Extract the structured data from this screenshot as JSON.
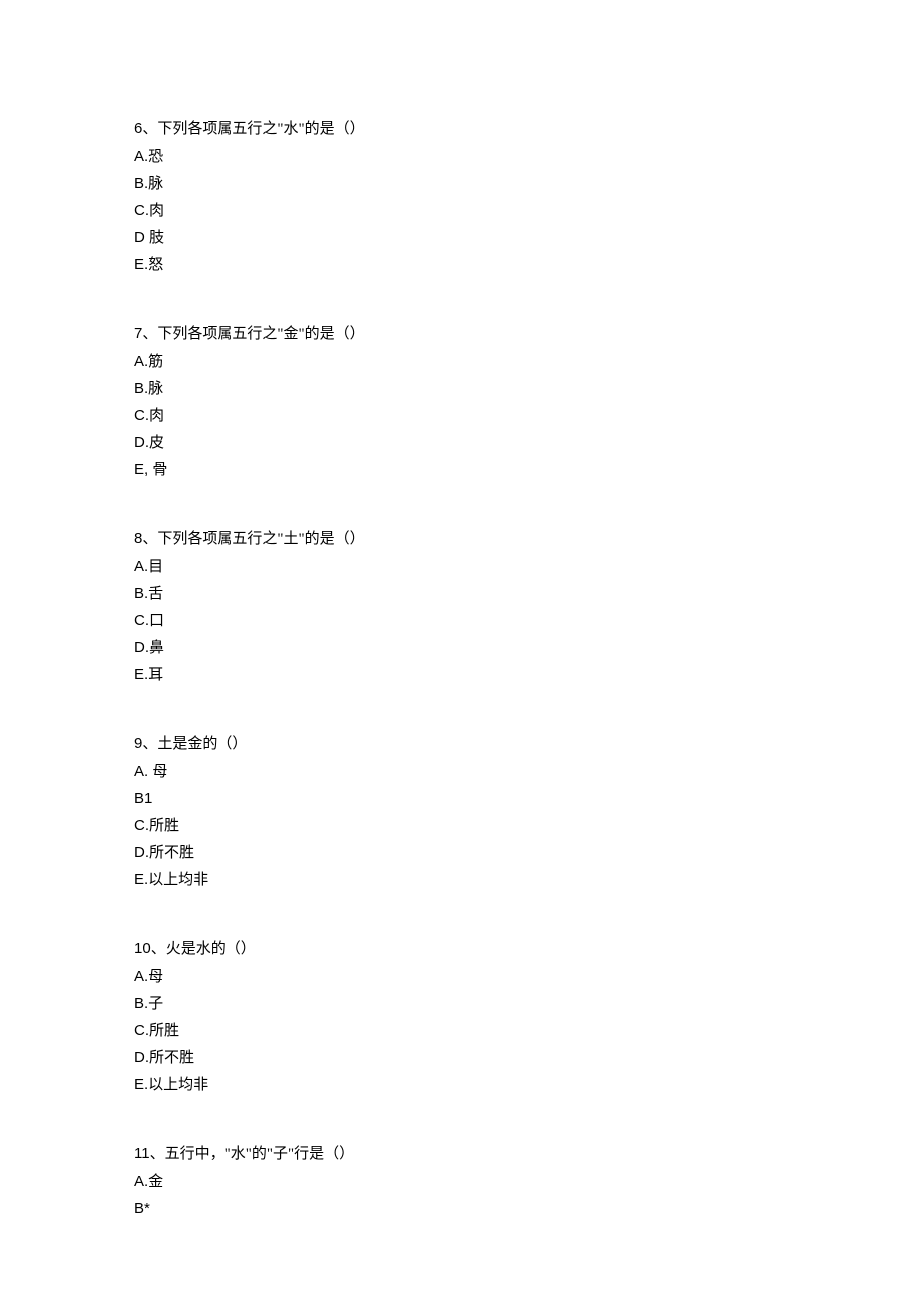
{
  "questions": [
    {
      "number": "6",
      "text": "、下列各项属五行之\"水\"的是（）",
      "options": [
        "A.恐",
        "B.脉",
        "C.肉",
        "D 肢",
        "E.怒"
      ]
    },
    {
      "number": "7",
      "text": "、下列各项属五行之\"金\"的是（）",
      "options": [
        "A.筋",
        "B.脉",
        "C.肉",
        "D.皮",
        "E, 骨"
      ]
    },
    {
      "number": "8",
      "text": "、下列各项属五行之\"土\"的是（）",
      "options": [
        "A.目",
        "B.舌",
        "C.口",
        "D.鼻",
        "E.耳"
      ]
    },
    {
      "number": "9",
      "text": "、土是金的（）",
      "options": [
        "A. 母",
        "B1",
        "C.所胜",
        "D.所不胜",
        "E.以上均非"
      ]
    },
    {
      "number": "10",
      "text": "、火是水的（）",
      "options": [
        "A.母",
        "B.子",
        "C.所胜",
        "D.所不胜",
        "E.以上均非"
      ]
    },
    {
      "number": "11",
      "text": "、五行中，\"水\"的\"子\"行是（）",
      "options": [
        "A.金",
        "B*"
      ]
    }
  ]
}
